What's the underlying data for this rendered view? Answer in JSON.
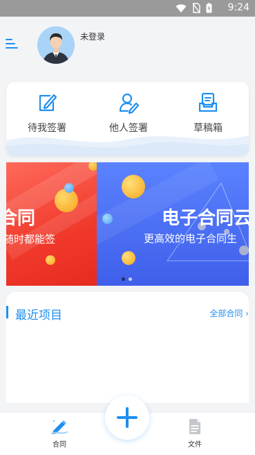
{
  "status_bar": {
    "time": "9:24",
    "icons": [
      "wifi-icon",
      "no-sim-icon",
      "battery-charging-icon"
    ]
  },
  "header": {
    "menu_icon": "menu-icon",
    "avatar_icon": "user-avatar",
    "login_status": "未登录"
  },
  "quick_actions": [
    {
      "label": "待我签署",
      "icon": "sign-pen-icon"
    },
    {
      "label": "他人签署",
      "icon": "person-pen-icon"
    },
    {
      "label": "草稿箱",
      "icon": "draft-box-icon"
    }
  ],
  "banner": {
    "slide_left": {
      "title": "合同",
      "subtitle": "随时都能签"
    },
    "slide_right": {
      "title": "电子合同云",
      "subtitle": "更高效的电子合同生"
    },
    "pagination": {
      "count": 2,
      "active": 0
    }
  },
  "recent": {
    "title": "最近项目",
    "all_link": "全部合同"
  },
  "tabbar": {
    "items": [
      {
        "label": "合同",
        "icon": "contract-icon"
      },
      {
        "label": "文件",
        "icon": "file-icon"
      }
    ],
    "center_button_icon": "plus-icon"
  },
  "colors": {
    "accent": "#1e8ff0",
    "status_bar": "#9a9a9a",
    "banner_red": "#f0392b",
    "banner_blue": "#4a6cf7",
    "background": "#f3f4f6"
  }
}
